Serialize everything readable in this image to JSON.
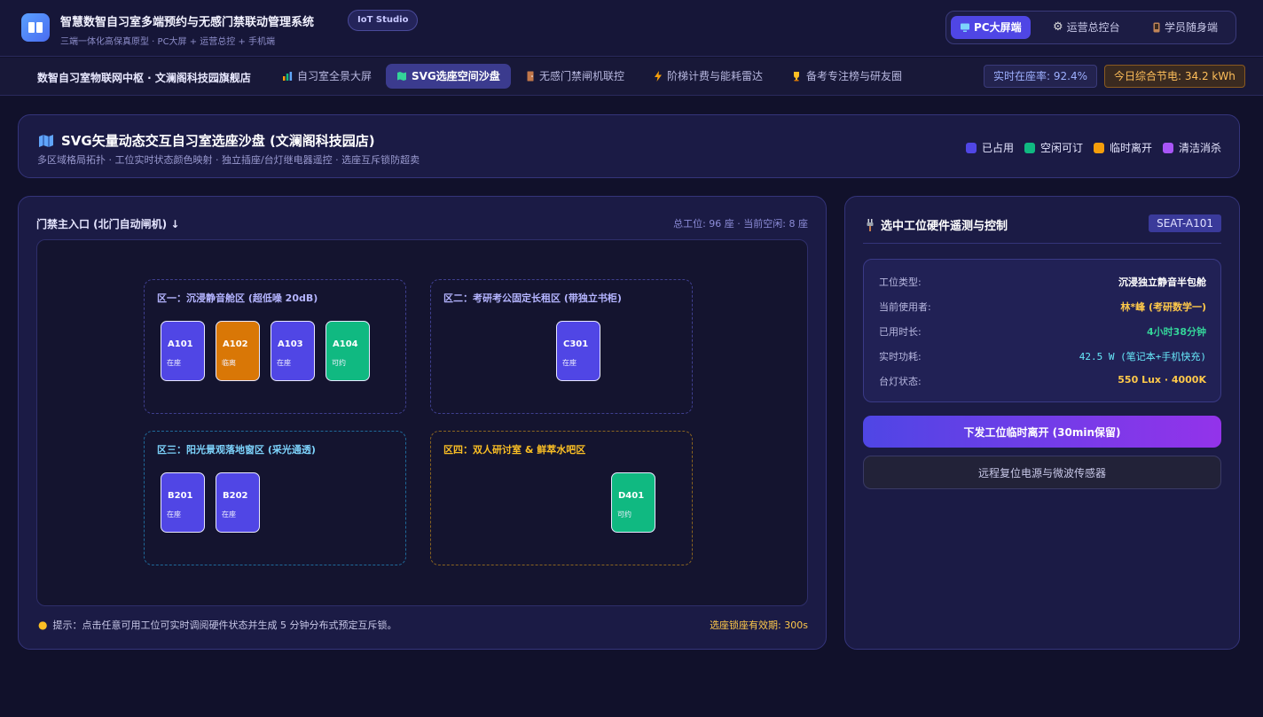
{
  "header": {
    "title": "智慧数智自习室多端预约与无感门禁联动管理系统",
    "badge": "IoT Studio",
    "subtitle": "三端一体化高保真原型 · PC大屏 + 运营总控 + 手机端",
    "modes": [
      {
        "label": "PC大屏端",
        "icon": "monitor-icon",
        "active": true
      },
      {
        "label": "运营总控台",
        "icon": "gear-icon",
        "active": false
      },
      {
        "label": "学员随身端",
        "icon": "phone-icon",
        "active": false
      }
    ]
  },
  "nav": {
    "site": "数智自习室物联网中枢 · 文澜阁科技园旗舰店",
    "tabs": [
      {
        "label": "自习室全景大屏",
        "icon": "chart-icon"
      },
      {
        "label": "SVG选座空间沙盘",
        "icon": "map-icon"
      },
      {
        "label": "无感门禁闸机联控",
        "icon": "door-icon"
      },
      {
        "label": "阶梯计费与能耗雷达",
        "icon": "bolt-icon"
      },
      {
        "label": "备考专注榜与研友圈",
        "icon": "trophy-icon"
      }
    ],
    "occupancy": "实时在座率: 92.4%",
    "energy": "今日综合节电: 34.2 kWh"
  },
  "hero": {
    "title": "SVG矢量动态交互自习室选座沙盘 (文澜阁科技园店)",
    "desc": "多区域格局拓扑 · 工位实时状态颜色映射 · 独立插座/台灯继电器遥控 · 选座互斥锁防超卖",
    "legend": [
      {
        "label": "已占用",
        "color": "#5046e5"
      },
      {
        "label": "空闲可订",
        "color": "#10b981"
      },
      {
        "label": "临时离开",
        "color": "#f59e0b"
      },
      {
        "label": "清洁消杀",
        "color": "#a855f7"
      }
    ]
  },
  "map": {
    "entrance": "门禁主入口 (北门自动闸机) ↓",
    "capacity": "总工位: 96 座 · 当前空闲: 8 座",
    "zones": [
      {
        "title": "区一：沉浸静音舱区 (超低噪 20dB)",
        "color": "#4f46e5",
        "seats": [
          {
            "id": "A101",
            "status": "在座",
            "state": "occupied"
          },
          {
            "id": "A102",
            "status": "临离",
            "state": "away"
          },
          {
            "id": "A103",
            "status": "在座",
            "state": "occupied"
          },
          {
            "id": "A104",
            "status": "可约",
            "state": "free"
          }
        ]
      },
      {
        "title": "区二：考研考公固定长租区 (带独立书柜)",
        "color": "#4f46e5",
        "seats": [
          {
            "id": "C301",
            "status": "在座",
            "state": "occupied"
          }
        ]
      },
      {
        "title": "区三：阳光景观落地窗区 (采光通透)",
        "color": "#0ea5e9",
        "seats": [
          {
            "id": "B201",
            "status": "在座",
            "state": "occupied"
          },
          {
            "id": "B202",
            "status": "在座",
            "state": "occupied"
          }
        ]
      },
      {
        "title": "区四：双人研讨室 & 鲜萃水吧区",
        "color": "#f59e0b",
        "seats": [
          {
            "id": "D401",
            "status": "可约",
            "state": "free"
          }
        ]
      }
    ],
    "tip": "提示：点击任意可用工位可实时调阅硬件状态并生成 5 分钟分布式预定互斥锁。",
    "lock": "选座锁座有效期: 300s"
  },
  "control": {
    "title": "选中工位硬件遥测与控制",
    "seat_code": "SEAT-A101",
    "rows": [
      {
        "label": "工位类型:",
        "value": "沉浸独立静音半包舱",
        "color": "#ffffff"
      },
      {
        "label": "当前使用者:",
        "value": "林*峰 (考研数学一)",
        "color": "#ffc94a"
      },
      {
        "label": "已用时长:",
        "value": "4小时38分钟",
        "color": "#34d399"
      },
      {
        "label": "实时功耗:",
        "value": "42.5 W (笔记本+手机快充)",
        "color": "#67e8f9"
      },
      {
        "label": "台灯状态:",
        "value": "550 Lux · 4000K",
        "color": "#ffc94a"
      }
    ],
    "primary_btn": "下发工位临时离开 (30min保留)",
    "secondary_btn": "远程复位电源与微波传感器"
  },
  "colors": {
    "occupied": "#5046e5",
    "away": "#d97706",
    "free": "#10b981"
  }
}
